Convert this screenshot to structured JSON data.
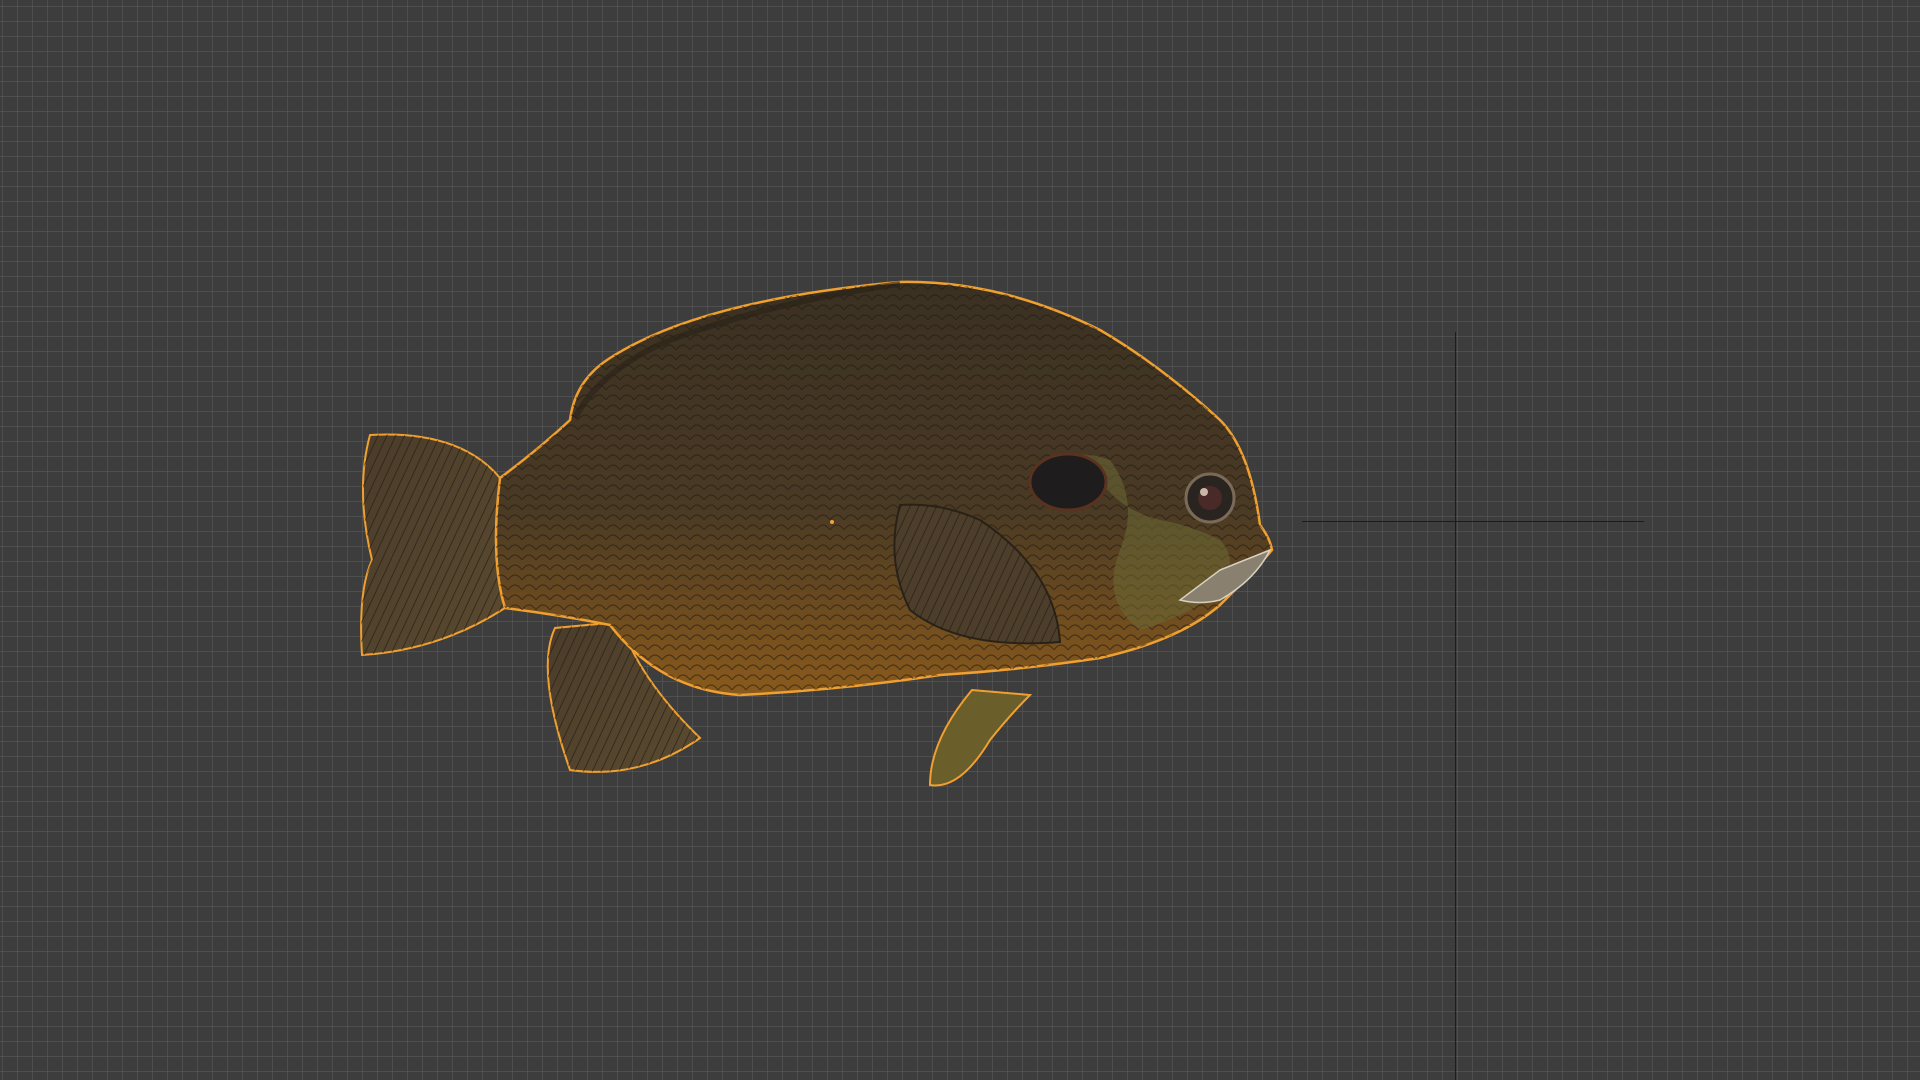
{
  "viewport": {
    "mode": "3d-viewport",
    "background_color": "#3d3d3d",
    "grid_color": "#5c5c5c",
    "axis_line_color": "#1c1c1c"
  },
  "selected_object": {
    "kind": "fish-model",
    "selected": true,
    "outline_color": "#f0a030",
    "colors": {
      "body_dark": "#3a3022",
      "body_mid": "#5a4628",
      "belly": "#8a5a1c",
      "fin": "#4a3c2a",
      "cheek": "#6b6a34",
      "spot": "#1e1c1c"
    }
  }
}
